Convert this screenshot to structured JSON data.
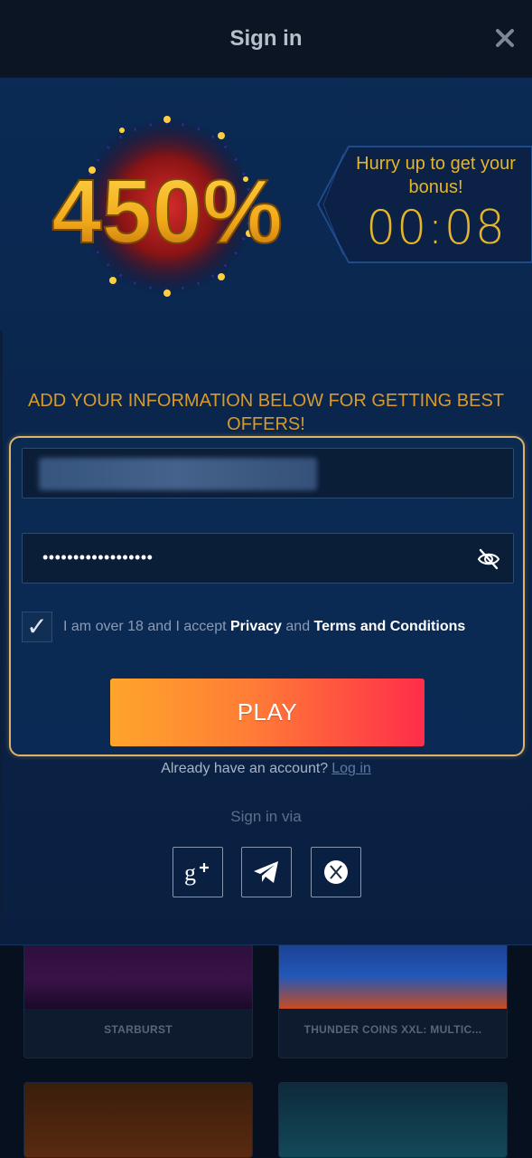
{
  "modal": {
    "title": "Sign in"
  },
  "promo": {
    "badge_text": "450%",
    "timer_message": "Hurry up to get your bonus!",
    "timer_value": "00:08"
  },
  "headline": "ADD YOUR INFORMATION BELOW FOR GETTING BEST OFFERS!",
  "form": {
    "email_value": "",
    "password_value": "••••••••••••••••••",
    "consent": {
      "checked": true,
      "prefix": "I am over 18 and I accept",
      "privacy": "Privacy",
      "and": "and",
      "terms": "Terms and Conditions"
    },
    "play_label": "PLAY"
  },
  "account": {
    "question": "Already have an account?",
    "login_label": "Log in"
  },
  "social": {
    "heading": "Sign in via",
    "providers": [
      "google-plus",
      "telegram",
      "x"
    ]
  },
  "background_games": [
    {
      "title": "STARBURST"
    },
    {
      "title": "THUNDER COINS XXL: MULTIC..."
    }
  ],
  "colors": {
    "accent_gold": "#e4b52c",
    "headline_orange": "#d99a2a",
    "play_gradient_start": "#ffa52b",
    "play_gradient_end": "#ff2d4a"
  }
}
